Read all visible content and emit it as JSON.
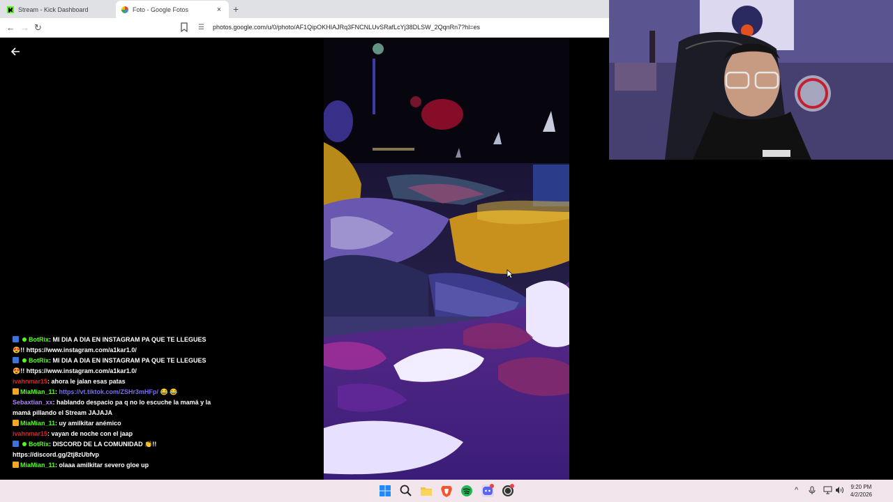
{
  "browser": {
    "tabs": [
      {
        "title": "Stream - Kick Dashboard",
        "active": false
      },
      {
        "title": "Foto - Google Fotos",
        "active": true
      }
    ],
    "new_tab": "+",
    "close_glyph": "×",
    "url": "photos.google.com/u/0/photo/AF1QipOKHIAJRq3FNCNLUvSRafLcYj38DLSW_2QqnRn7?hl=es"
  },
  "viewer": {
    "back_icon": "arrow-left-icon"
  },
  "chat": {
    "messages": [
      {
        "user": "BotRix",
        "user_class": "u-green",
        "badges": [
          "kick",
          "bot"
        ],
        "text": ": MI DIA A DIA EN INSTAGRAM PA QUE TE LLEGUES 😍!! https://www.instagram.com/a1kar1.0/"
      },
      {
        "user": "BotRix",
        "user_class": "u-green",
        "badges": [
          "kick",
          "bot"
        ],
        "text": ": MI DIA A DIA EN INSTAGRAM PA QUE TE LLEGUES 😍!! https://www.instagram.com/a1kar1.0/"
      },
      {
        "user": "ivahnmar15",
        "user_class": "u-red",
        "badges": [],
        "text": ": ahora le jalan esas patas"
      },
      {
        "user": "MiaMian_11",
        "user_class": "u-green",
        "badges": [
          "sub"
        ],
        "link": "https://vt.tiktok.com/ZSHr3mHFp/",
        "text": ": ",
        "after": " 😂 😂"
      },
      {
        "user": "Sebaxtian_xx",
        "user_class": "u-purple",
        "badges": [],
        "text": ": hablando despacio pa q no lo escuche la mamá y la mamá pillando el Stream JAJAJA"
      },
      {
        "user": "MiaMian_11",
        "user_class": "u-green",
        "badges": [
          "sub"
        ],
        "text": ": uy amilkitar anémico"
      },
      {
        "user": "ivahnmar15",
        "user_class": "u-red",
        "badges": [],
        "text": ": vayan de noche con el jaap"
      },
      {
        "user": "BotRix",
        "user_class": "u-green",
        "badges": [
          "kick",
          "bot"
        ],
        "text": ": DISCORD DE LA COMUNIDAD 👏!! https://discord.gg/2tj8zUbfvp"
      },
      {
        "user": "MiaMian_11",
        "user_class": "u-green",
        "badges": [
          "sub"
        ],
        "text": ": olaaa amilkitar severo gloe up"
      }
    ]
  },
  "taskbar": {
    "icons": [
      "windows-start-icon",
      "search-icon",
      "file-explorer-icon",
      "brave-browser-icon",
      "spotify-icon",
      "discord-icon",
      "obs-icon"
    ],
    "tray": {
      "chevron": "^",
      "time": "9:20 PM",
      "date": "4/2/2026"
    }
  },
  "colors": {
    "kick_green": "#53fc18",
    "taskbar_bg": "#f2e6ec",
    "chrome_tab_bg": "#dfe1e5"
  }
}
